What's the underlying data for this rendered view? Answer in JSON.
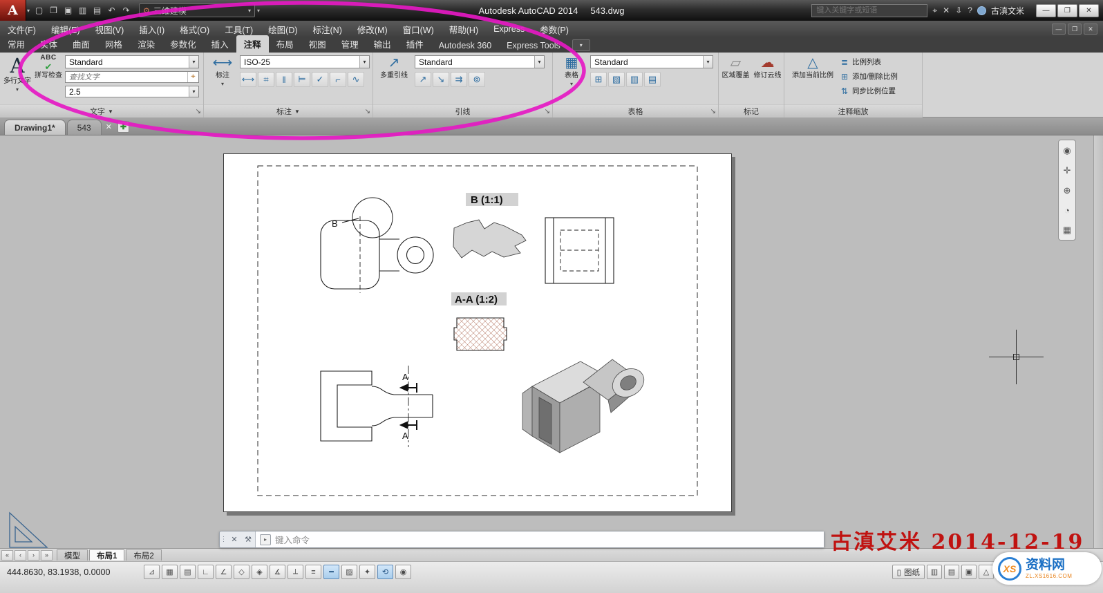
{
  "titlebar": {
    "logo_letter": "A",
    "workspace": "三维建模",
    "app_title": "Autodesk AutoCAD 2014",
    "doc_title": "543.dwg",
    "search_placeholder": "键入关键字或短语",
    "user": "古滇文米",
    "qat": [
      {
        "name": "new-file-icon",
        "glyph": "▢"
      },
      {
        "name": "open-file-icon",
        "glyph": "❒"
      },
      {
        "name": "save-icon",
        "glyph": "▣"
      },
      {
        "name": "save-as-icon",
        "glyph": "▥"
      },
      {
        "name": "plot-icon",
        "glyph": "▤"
      },
      {
        "name": "undo-icon",
        "glyph": "↶"
      },
      {
        "name": "redo-icon",
        "glyph": "↷"
      }
    ],
    "infocenter_icons": [
      {
        "name": "search-go-icon",
        "glyph": "⌖"
      },
      {
        "name": "exchange-apps-icon",
        "glyph": "✕"
      },
      {
        "name": "a360-icon",
        "glyph": "⇩"
      },
      {
        "name": "help-icon",
        "glyph": "?"
      }
    ],
    "window_controls": [
      {
        "name": "minimize-button",
        "glyph": "—"
      },
      {
        "name": "restore-button",
        "glyph": "❐"
      },
      {
        "name": "close-button",
        "glyph": "✕"
      }
    ]
  },
  "menubar": {
    "items": [
      "文件(F)",
      "编辑(E)",
      "视图(V)",
      "插入(I)",
      "格式(O)",
      "工具(T)",
      "绘图(D)",
      "标注(N)",
      "修改(M)",
      "窗口(W)",
      "帮助(H)",
      "Express",
      "参数(P)"
    ],
    "window_controls": [
      {
        "name": "doc-minimize-button",
        "glyph": "—"
      },
      {
        "name": "doc-restore-button",
        "glyph": "❐"
      },
      {
        "name": "doc-close-button",
        "glyph": "✕"
      }
    ]
  },
  "ribbon": {
    "tabs": [
      {
        "label": "常用"
      },
      {
        "label": "实体"
      },
      {
        "label": "曲面"
      },
      {
        "label": "网格"
      },
      {
        "label": "渲染"
      },
      {
        "label": "参数化"
      },
      {
        "label": "插入"
      },
      {
        "label": "注释",
        "active": true
      },
      {
        "label": "布局"
      },
      {
        "label": "视图"
      },
      {
        "label": "管理"
      },
      {
        "label": "输出"
      },
      {
        "label": "插件"
      },
      {
        "label": "Autodesk 360"
      },
      {
        "label": "Express Tools"
      }
    ],
    "panels": {
      "text": {
        "title": "文字",
        "big_letter": "A",
        "mtext_label": "多行文字",
        "spell_abc": "ABC",
        "spell_label": "拼写检查",
        "style_value": "Standard",
        "find_placeholder": "查找文字",
        "height_value": "2.5"
      },
      "dimension": {
        "title": "标注",
        "button_label": "标注",
        "style_value": "ISO-25",
        "tools": [
          {
            "name": "dim-linear-icon",
            "glyph": "⟷"
          },
          {
            "name": "dim-quick-icon",
            "glyph": "⌗"
          },
          {
            "name": "dim-continue-icon",
            "glyph": "‖"
          },
          {
            "name": "dim-baseline-icon",
            "glyph": "⊨"
          },
          {
            "name": "dim-inspect-icon",
            "glyph": "✓"
          },
          {
            "name": "dim-update-icon",
            "glyph": "⌐"
          },
          {
            "name": "dim-jog-icon",
            "glyph": "∿"
          }
        ]
      },
      "leader": {
        "title": "引线",
        "button_label": "多重引线",
        "style_value": "Standard",
        "tools": [
          {
            "name": "mleader-add-icon",
            "glyph": "↗"
          },
          {
            "name": "mleader-remove-icon",
            "glyph": "↘"
          },
          {
            "name": "mleader-align-icon",
            "glyph": "⇉"
          },
          {
            "name": "mleader-collect-icon",
            "glyph": "⊚"
          }
        ]
      },
      "table": {
        "title": "表格",
        "button_label": "表格",
        "style_value": "Standard",
        "tools": [
          {
            "name": "table-extract-icon",
            "glyph": "⊞"
          },
          {
            "name": "table-data-link-icon",
            "glyph": "▧"
          },
          {
            "name": "table-export-icon",
            "glyph": "▥"
          },
          {
            "name": "table-cell-icon",
            "glyph": "▤"
          }
        ]
      },
      "markup": {
        "title": "标记",
        "wipeout_label": "区域覆盖",
        "revcloud_label": "修订云线"
      },
      "annotation_scaling": {
        "title": "注释缩放",
        "add_current_label": "添加当前比例",
        "items": [
          {
            "name": "scale-list-button",
            "glyph": "≣",
            "label": "比例列表"
          },
          {
            "name": "add-delete-scales-button",
            "glyph": "⊞",
            "label": "添加/删除比例"
          },
          {
            "name": "sync-scale-positions-button",
            "glyph": "⇅",
            "label": "同步比例位置"
          }
        ]
      }
    }
  },
  "file_tabs": {
    "tabs": [
      {
        "label": "Drawing1*",
        "active": true
      },
      {
        "label": "543"
      }
    ],
    "close_glyph": "✕",
    "new_tab_glyph": "✚"
  },
  "drawing": {
    "labels": {
      "detail": "B (1:1)",
      "section": "A-A (1:2)",
      "marker_b": "B",
      "marker_a_top": "A",
      "marker_a_bottom": "A"
    }
  },
  "command_line": {
    "close_glyph": "✕",
    "customize_glyph": "⚒",
    "prompt_glyph": "▸",
    "placeholder": "键入命令"
  },
  "layout_bar": {
    "nav": [
      {
        "name": "first-layout-button",
        "glyph": "«"
      },
      {
        "name": "prev-layout-button",
        "glyph": "‹"
      },
      {
        "name": "next-layout-button",
        "glyph": "›"
      },
      {
        "name": "last-layout-button",
        "glyph": "»"
      }
    ],
    "tabs": [
      {
        "label": "模型"
      },
      {
        "label": "布局1",
        "active": true
      },
      {
        "label": "布局2"
      }
    ]
  },
  "status_bar": {
    "coords": "444.8630, 83.1938, 0.0000",
    "toggles": [
      {
        "name": "infer-constraints-toggle",
        "glyph": "⊿"
      },
      {
        "name": "snap-toggle",
        "glyph": "▦"
      },
      {
        "name": "grid-toggle",
        "glyph": "▤"
      },
      {
        "name": "ortho-toggle",
        "glyph": "∟"
      },
      {
        "name": "polar-toggle",
        "glyph": "∠"
      },
      {
        "name": "osnap-toggle",
        "glyph": "◇"
      },
      {
        "name": "osnap-3d-toggle",
        "glyph": "◈"
      },
      {
        "name": "otrack-toggle",
        "glyph": "∡"
      },
      {
        "name": "ducs-toggle",
        "glyph": "⟂"
      },
      {
        "name": "dyn-toggle",
        "glyph": "≡"
      },
      {
        "name": "lineweight-toggle",
        "glyph": "━",
        "active": true
      },
      {
        "name": "transparency-toggle",
        "glyph": "▨"
      },
      {
        "name": "quick-properties-toggle",
        "glyph": "✦"
      },
      {
        "name": "selection-cycling-toggle",
        "glyph": "⟲",
        "active": true
      },
      {
        "name": "annotation-monitor-toggle",
        "glyph": "◉"
      }
    ],
    "paper_label": "图纸",
    "paper_icon": "▯",
    "right_icons": [
      {
        "name": "quick-view-layouts-icon",
        "glyph": "▥"
      },
      {
        "name": "quick-view-drawings-icon",
        "glyph": "▤"
      },
      {
        "name": "model-space-icon",
        "glyph": "▣"
      },
      {
        "name": "annotation-scale-icon",
        "glyph": "△"
      },
      {
        "name": "annotation-visibility-icon",
        "glyph": "◬"
      },
      {
        "name": "auto-add-scales-icon",
        "glyph": "⟳"
      },
      {
        "name": "workspace-switching-icon",
        "glyph": "⚙"
      },
      {
        "name": "toolbar-lock-icon",
        "glyph": "⊘"
      },
      {
        "name": "isolate-objects-icon",
        "glyph": "◎"
      },
      {
        "name": "clean-screen-icon",
        "glyph": "❐"
      }
    ]
  },
  "navbar": {
    "icons": [
      {
        "name": "full-navigation-wheel-icon",
        "glyph": "◉"
      },
      {
        "name": "pan-icon",
        "glyph": "✛"
      },
      {
        "name": "zoom-icon",
        "glyph": "⊕"
      },
      {
        "name": "orbit-icon",
        "glyph": "◔"
      },
      {
        "name": "showmotion-icon",
        "glyph": "▦"
      }
    ]
  },
  "watermarks": {
    "red_text": "古滇艾米 2014-12-19",
    "logo_xs": "XS",
    "logo_name": "资料网",
    "logo_url": "ZL.XS1616.COM"
  },
  "colors": {
    "annotation_ellipse": "#e519c3",
    "hatch": "#a05138",
    "red_watermark": "#c01210"
  }
}
